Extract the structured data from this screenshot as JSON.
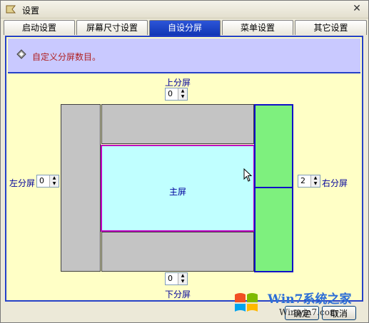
{
  "window": {
    "title": "设置"
  },
  "tabs": [
    {
      "label": "启动设置"
    },
    {
      "label": "屏幕尺寸设置"
    },
    {
      "label": "自设分屏",
      "active": true
    },
    {
      "label": "菜单设置"
    },
    {
      "label": "其它设置"
    }
  ],
  "header": {
    "text": "自定义分屏数目。"
  },
  "splits": {
    "top": {
      "label": "上分屏",
      "value": "0"
    },
    "bottom": {
      "label": "下分屏",
      "value": "0"
    },
    "left": {
      "label": "左分屏",
      "value": "0"
    },
    "right": {
      "label": "右分屏",
      "value": "2"
    }
  },
  "main_screen": {
    "label": "主屏"
  },
  "buttons": {
    "ok": "确定",
    "cancel": "取消"
  },
  "watermark": {
    "text": "Win7系统之家",
    "url": "Winwin7.com"
  },
  "colors": {
    "accent": "#1136b4",
    "panel_bg": "#ffffc6",
    "header_bg": "#c9c9ff",
    "main_screen_bg": "#c0ffff",
    "side_green": "#7ef07e",
    "side_gray": "#c4c4c4"
  }
}
